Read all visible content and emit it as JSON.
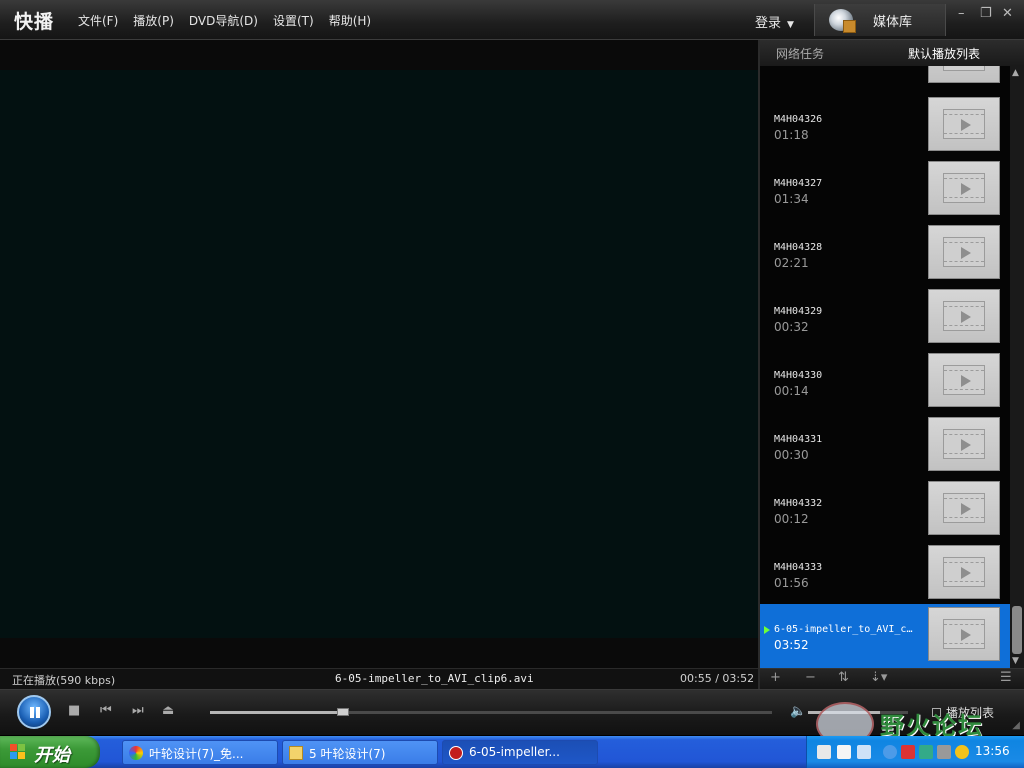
{
  "app": {
    "logo": "快播",
    "menu": [
      "文件(F)",
      "播放(P)",
      "DVD导航(D)",
      "设置(T)",
      "帮助(H)"
    ],
    "login": "登录",
    "media_library": "媒体库",
    "window_buttons": {
      "minimize": "–",
      "restore": "❐",
      "close": "✕"
    }
  },
  "status": {
    "left": "正在播放(590 kbps)",
    "file": "6-05-impeller_to_AVI_clip6.avi",
    "time": "00:55 / 03:52"
  },
  "playback": {
    "progress": 0.237,
    "volume": 0.72
  },
  "panel": {
    "tab_network": "网络任务",
    "tab_playlist": "默认播放列表",
    "items": [
      {
        "name": "M4H04326",
        "duration": "01:18"
      },
      {
        "name": "M4H04327",
        "duration": "01:34"
      },
      {
        "name": "M4H04328",
        "duration": "02:21"
      },
      {
        "name": "M4H04329",
        "duration": "00:32"
      },
      {
        "name": "M4H04330",
        "duration": "00:14"
      },
      {
        "name": "M4H04331",
        "duration": "00:30"
      },
      {
        "name": "M4H04332",
        "duration": "00:12"
      },
      {
        "name": "M4H04333",
        "duration": "01:56"
      },
      {
        "name": "6-05-impeller_to_AVI_c…",
        "duration": "03:52"
      }
    ],
    "toolbar": [
      "+",
      "−",
      "⇅",
      "⇣▾",
      "☰"
    ]
  },
  "controls": {
    "playlist_label": "播放列表"
  },
  "watermark": {
    "text": "野火论坛"
  },
  "taskbar": {
    "start": "开始",
    "buttons": [
      "叶轮设计(7)_免...",
      "5 叶轮设计(7)",
      "6-05-impeller..."
    ],
    "clock": "13:56"
  }
}
